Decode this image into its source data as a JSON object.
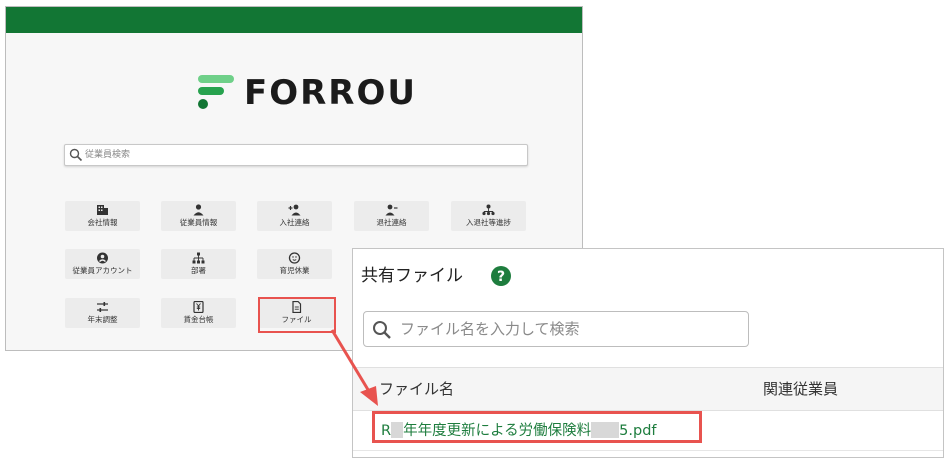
{
  "app": {
    "logo_text": "FORROU",
    "search": {
      "placeholder": "従業員検索"
    },
    "tiles": [
      {
        "label": "会社情報",
        "icon": "building-icon"
      },
      {
        "label": "従業員情報",
        "icon": "person-icon"
      },
      {
        "label": "入社連絡",
        "icon": "person-add-icon"
      },
      {
        "label": "退社連絡",
        "icon": "person-remove-icon"
      },
      {
        "label": "入退社等進捗",
        "icon": "progress-tree-icon"
      },
      {
        "label": "従業員アカウント",
        "icon": "account-circle-icon"
      },
      {
        "label": "部署",
        "icon": "org-chart-icon"
      },
      {
        "label": "育児休業",
        "icon": "baby-icon"
      },
      {
        "label": "年末調整",
        "icon": "sliders-icon"
      },
      {
        "label": "賃金台帳",
        "icon": "yen-book-icon"
      },
      {
        "label": "ファイル",
        "icon": "file-icon"
      }
    ],
    "colors": {
      "header": "#127634",
      "accent": "#1e7d3e",
      "highlight": "#e8534f"
    }
  },
  "zoom": {
    "title": "共有ファイル",
    "help_icon": "question-circle-icon",
    "search_placeholder": "ファイル名を入力して検索",
    "table": {
      "headers": [
        "ファイル名",
        "関連従業員"
      ],
      "rows": [
        {
          "file_prefix": "R",
          "file_middle": "年年度更新による労働保険料",
          "file_suffix": "5.pdf"
        }
      ]
    }
  }
}
